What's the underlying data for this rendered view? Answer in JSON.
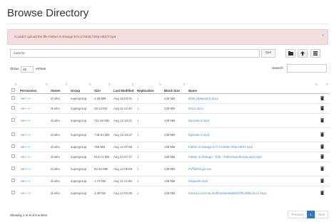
{
  "page": {
    "title": "Browse Directory"
  },
  "alert": {
    "message": "Couldn't upload the file Father is strange EYI.173408.720p.HEXT.mp4",
    "close": "×"
  },
  "toolbar": {
    "path_value": "/user/yt",
    "go_label": "Go!"
  },
  "controls": {
    "show_label": "Show",
    "entries_value": "25",
    "entries_label": "entries",
    "search_label": "Search:"
  },
  "table": {
    "headers": [
      "Permission",
      "Owner",
      "Group",
      "Size",
      "Last Modified",
      "Replication",
      "Block Size",
      "Name"
    ],
    "rows": [
      {
        "permission": "-rw-r--r--",
        "owner": "dr.who",
        "group": "supergroup",
        "size": "2.28 MB",
        "modified": "Aug 16 03:31",
        "replication": "1",
        "block": "128 MB",
        "name": "BAB_Njaeipu(1).docx"
      },
      {
        "permission": "-rw-r--r--",
        "owner": "dr.who",
        "group": "supergroup",
        "size": "28.13 KB",
        "modified": "Aug 11 14:40",
        "replication": "1",
        "block": "128 MB",
        "name": "Doc1.docx"
      },
      {
        "permission": "-rw-r--r--",
        "owner": "dr.who",
        "group": "supergroup",
        "size": "711.94 MB",
        "modified": "Aug 12 16:21",
        "replication": "1",
        "block": "128 MB",
        "name": "Episode 2.mp4"
      },
      {
        "permission": "-rw-r--r--",
        "owner": "dr.who",
        "group": "supergroup",
        "size": "746.91 MB",
        "modified": "Aug 12 16:27",
        "replication": "1",
        "block": "128 MB",
        "name": "Episode 3.mp4"
      },
      {
        "permission": "-rw-r--r--",
        "owner": "dr.who",
        "group": "supergroup",
        "size": "765 MB",
        "modified": "Aug 14 07:50",
        "replication": "1",
        "block": "128 MB",
        "name": "Father is strange EYI.173408.720p.HEXT.mp4"
      },
      {
        "permission": "-rw-r--r--",
        "owner": "dr.who",
        "group": "supergroup",
        "size": "614.71 MB",
        "modified": "Aug 14 07:47",
        "replication": "1",
        "block": "128 MB",
        "name": "Father is Strange - E30 - OnDemandKorea.asm.mp4"
      },
      {
        "permission": "-rw-r--r--",
        "owner": "dr.who",
        "group": "supergroup",
        "size": "92.52 MB",
        "modified": "Aug 14 05:59",
        "replication": "1",
        "block": "128 MB",
        "name": "Puffinfish.go.exe"
      },
      {
        "permission": "-rw-r--r--",
        "owner": "dr.who",
        "group": "supergroup",
        "size": "1.73 GB",
        "modified": "Aug 11 14:08",
        "replication": "1",
        "block": "128 MB",
        "name": "Rapsank.mp4"
      },
      {
        "permission": "-rw-r--r--",
        "owner": "dr.who",
        "group": "supergroup",
        "size": "3.38 GB",
        "modified": "Aug 14 02:28",
        "replication": "1",
        "block": "128 MB",
        "name": "torious1.com-mL3a4fb4e0ae5a283d79fc4f8bc/our1.mp4"
      }
    ]
  },
  "footer": {
    "showing": "Showing 1 to 9 of 9 entries",
    "previous": "Previous",
    "page": "1",
    "next": "Next"
  },
  "icons": [
    "upload-icon",
    "folder-plus-icon",
    "grid-icon",
    "trash-icon"
  ],
  "colors": {
    "alert_bg": "#f2dede",
    "alert_text": "#a94442",
    "link": "#4a8bc2",
    "primary": "#337ab7"
  }
}
